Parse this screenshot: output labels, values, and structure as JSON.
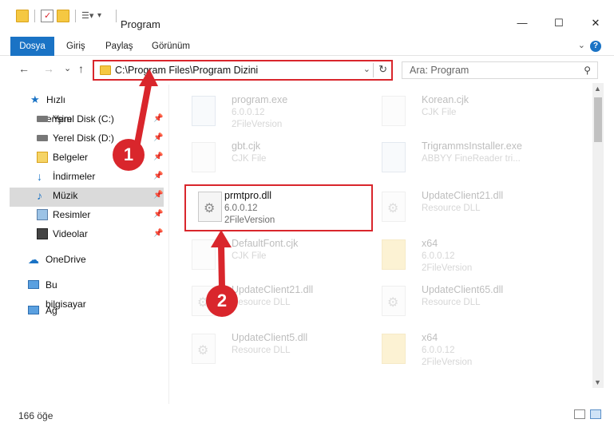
{
  "window": {
    "title": "Program",
    "controls": {
      "minimize": "—",
      "maximize": "☐",
      "close": "✕"
    }
  },
  "ribbon": {
    "tabs": [
      {
        "label": "Dosya",
        "active": true
      },
      {
        "label": "Giriş",
        "active": false
      },
      {
        "label": "Paylaş",
        "active": false
      },
      {
        "label": "Görünüm",
        "active": false
      }
    ],
    "help": "?"
  },
  "nav": {
    "back": "←",
    "forward": "→",
    "recent": "⌄",
    "up": "↑",
    "address": "C:\\Program Files\\Program Dizini",
    "search_placeholder": "Ara: Program"
  },
  "sidebar": {
    "quick_access": "Hızlı erişim",
    "items": [
      {
        "label": "Yerel Disk (C:)",
        "icon": "drive-icon",
        "pinned": true
      },
      {
        "label": "Yerel Disk (D:)",
        "icon": "drive-icon",
        "pinned": true
      },
      {
        "label": "Belgeler",
        "icon": "documents-icon",
        "pinned": true
      },
      {
        "label": "İndirmeler",
        "icon": "download-icon",
        "pinned": true
      },
      {
        "label": "Müzik",
        "icon": "music-icon",
        "pinned": true
      },
      {
        "label": "Resimler",
        "icon": "pictures-icon",
        "pinned": true
      },
      {
        "label": "Videolar",
        "icon": "videos-icon",
        "pinned": true
      }
    ],
    "onedrive": "OneDrive",
    "this_pc": "Bu bilgisayar",
    "network": "Ağ"
  },
  "files": [
    {
      "name": "program.exe",
      "line1": "6.0.0.12",
      "line2": "2FileVersion",
      "type": "exe",
      "faded": true
    },
    {
      "name": "Korean.cjk",
      "line1": "CJK File",
      "line2": "",
      "type": "file",
      "faded": true
    },
    {
      "name": "gbt.cjk",
      "line1": "CJK File",
      "line2": "",
      "type": "file",
      "faded": true
    },
    {
      "name": "TrigrammsInstaller.exe",
      "line1": "ABBYY FineReader tri...",
      "line2": "",
      "type": "exe",
      "faded": true
    },
    {
      "name": "prmtpro.dll",
      "line1": "6.0.0.12",
      "line2": "2FileVersion",
      "type": "dll",
      "faded": false
    },
    {
      "name": "UpdateClient21.dll",
      "line1": "Resource DLL",
      "line2": "",
      "type": "dll",
      "faded": true
    },
    {
      "name": "DefaultFont.cjk",
      "line1": "CJK File",
      "line2": "",
      "type": "file",
      "faded": true
    },
    {
      "name": "x64",
      "line1": "6.0.0.12",
      "line2": "2FileVersion",
      "type": "folder",
      "faded": true
    },
    {
      "name": "UpdateClient21.dll",
      "line1": "Resource DLL",
      "line2": "",
      "type": "dll",
      "faded": true
    },
    {
      "name": "UpdateClient65.dll",
      "line1": "Resource DLL",
      "line2": "",
      "type": "dll",
      "faded": true
    },
    {
      "name": "UpdateClient5.dll",
      "line1": "Resource DLL",
      "line2": "",
      "type": "dll",
      "faded": true
    },
    {
      "name": "x64",
      "line1": "6.0.0.12",
      "line2": "2FileVersion",
      "type": "folder",
      "faded": true
    }
  ],
  "status": {
    "count": "166 öğe"
  },
  "annotations": {
    "step1": "1",
    "step2": "2"
  },
  "colors": {
    "accent": "#1a73c5",
    "highlight": "#d9262c"
  }
}
